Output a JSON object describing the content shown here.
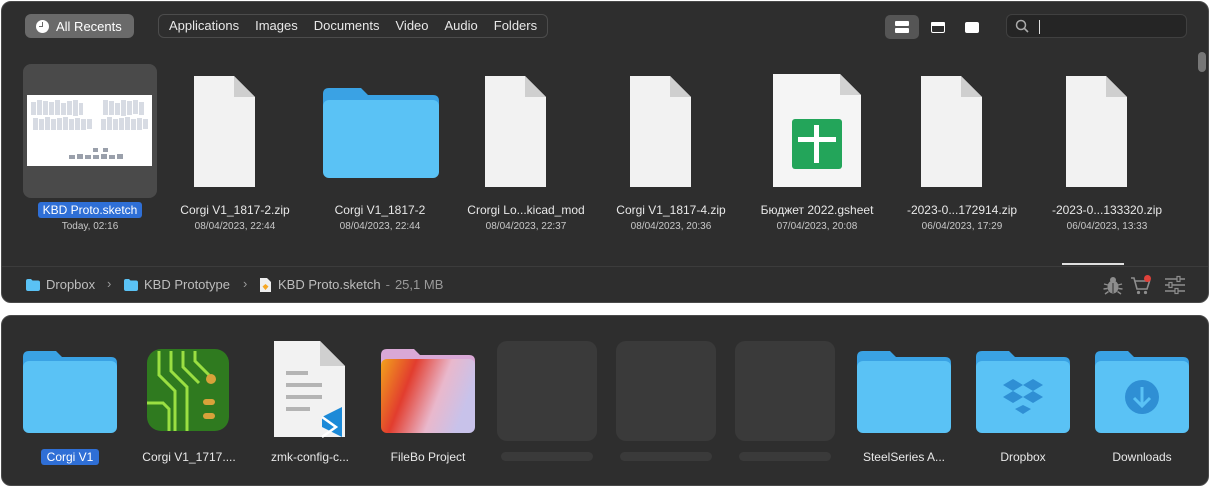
{
  "toolbar": {
    "recents_label": "All Recents",
    "filters": [
      "Applications",
      "Images",
      "Documents",
      "Video",
      "Audio",
      "Folders"
    ],
    "view_modes": [
      "large-icons",
      "list",
      "gallery"
    ],
    "search_value": ""
  },
  "recents": [
    {
      "name": "KBD Proto.sketch",
      "date": "Today, 02:16",
      "kind": "sketch-preview",
      "selected": true
    },
    {
      "name": "Corgi V1_1817-2.zip",
      "date": "08/04/2023, 22:44",
      "kind": "document"
    },
    {
      "name": "Corgi V1_1817-2",
      "date": "08/04/2023, 22:44",
      "kind": "folder"
    },
    {
      "name": "Crorgi Lo...kicad_mod",
      "date": "08/04/2023, 22:37",
      "kind": "document"
    },
    {
      "name": "Corgi V1_1817-4.zip",
      "date": "08/04/2023, 20:36",
      "kind": "document"
    },
    {
      "name": "Бюджет 2022.gsheet",
      "date": "07/04/2023, 20:08",
      "kind": "gsheet"
    },
    {
      "name": "-2023-0...172914.zip",
      "date": "06/04/2023, 17:29",
      "kind": "document"
    },
    {
      "name": "-2023-0...133320.zip",
      "date": "06/04/2023, 13:33",
      "kind": "document"
    }
  ],
  "path": {
    "segments": [
      "Dropbox",
      "KBD Prototype",
      "KBD Proto.sketch"
    ],
    "size": "25,1 MB"
  },
  "status_icons": [
    "bug-icon",
    "cart-icon",
    "sliders-icon"
  ],
  "shelf": [
    {
      "name": "Corgi V1",
      "kind": "folder",
      "selected": true
    },
    {
      "name": "Corgi V1_1717....",
      "kind": "pcb"
    },
    {
      "name": "zmk-config-c...",
      "kind": "vscode-doc"
    },
    {
      "name": "FileBo Project",
      "kind": "project-folder"
    },
    {
      "name": "",
      "kind": "empty"
    },
    {
      "name": "",
      "kind": "empty"
    },
    {
      "name": "",
      "kind": "empty"
    },
    {
      "name": "SteelSeries A...",
      "kind": "folder"
    },
    {
      "name": "Dropbox",
      "kind": "dropbox-folder"
    },
    {
      "name": "Downloads",
      "kind": "downloads-folder"
    }
  ],
  "colors": {
    "panel": "#2e2e2e",
    "selection": "#2f6fd6",
    "folder": "#5ac2f5",
    "sheet_green": "#23a55a"
  }
}
